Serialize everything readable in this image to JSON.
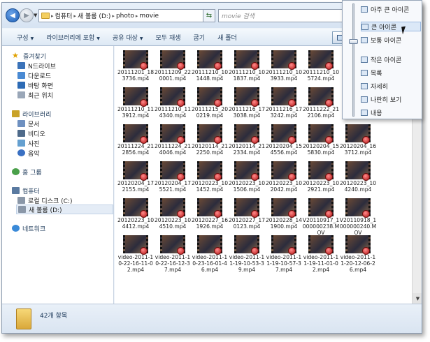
{
  "address": {
    "crumbs": [
      "컴퓨터",
      "새 볼륨 (D:)",
      "photo",
      "movie"
    ],
    "search_placeholder": "movie 검색"
  },
  "toolbar": {
    "organize": "구성",
    "include_library": "라이브러리에 포함",
    "share": "공유 대상",
    "play_all": "모두 재생",
    "burn": "굽기",
    "new_folder": "새 폴더"
  },
  "nav": {
    "favorites": "즐겨찾기",
    "ndrive": "N드라이브",
    "downloads": "다운로드",
    "desktop": "바탕 화면",
    "recent": "최근 위치",
    "libraries": "라이브러리",
    "documents": "문서",
    "videos": "비디오",
    "pictures": "사진",
    "music": "음악",
    "homegroup": "홈 그룹",
    "computer": "컴퓨터",
    "local_disk": "로컬 디스크 (C:)",
    "new_volume": "새 볼륨 (D:)",
    "network": "네트워크"
  },
  "files": [
    "20111201_183736.mp4",
    "20111209_220001.mp4",
    "20111210_101448.mp4",
    "20111210_101837.mp4",
    "20111210_103933.mp4",
    "20111210_105724.mp4",
    "",
    "20111210_113912.mp4",
    "20111210_114340.mp4",
    "20111215_200219.mp4",
    "20111216_173038.mp4",
    "20111216_173242.mp4",
    "20111222_212106.mp4",
    "",
    "20111224_212856.mp4",
    "20111224_214046.mp4",
    "20120114_212250.mp4",
    "20120114_212334.mp4",
    "20120204_154556.mp4",
    "20120204_155830.mp4",
    "20120204_163712.mp4",
    "20120204_172155.mp4",
    "20120204_175521.mp4",
    "20120223_101452.mp4",
    "20120223_101506.mp4",
    "20120223_102042.mp4",
    "20120223_102921.mp4",
    "20120223_104240.mp4",
    "20120223_104412.mp4",
    "20120223_104510.mp4",
    "20120227_161926.mp4",
    "20120227_170123.mp4",
    "20120228_141900.mp4",
    "V20110917_1000000238.MOV",
    "V20110918_1000000240.MOV",
    "video-2011-10-22-16-11-02.mp4",
    "video-2011-10-22-16-12-37.mp4",
    "video-2011-10-23-16-01-46.mp4",
    "video-2011-11-19-10-53-39.mp4",
    "video-2011-11-19-10-57-37.mp4",
    "video-2011-11-19-11-01-02.mp4",
    "video-2011-11-20-12-06-26.mp4"
  ],
  "status": {
    "count": "42개 항목"
  },
  "view_menu": {
    "extra_large": "아주 큰 아이콘",
    "large": "큰 아이콘",
    "medium": "보통 아이콘",
    "small": "작은 아이콘",
    "list": "목록",
    "details": "자세히",
    "tiles": "나란히 보기",
    "content": "내용"
  }
}
